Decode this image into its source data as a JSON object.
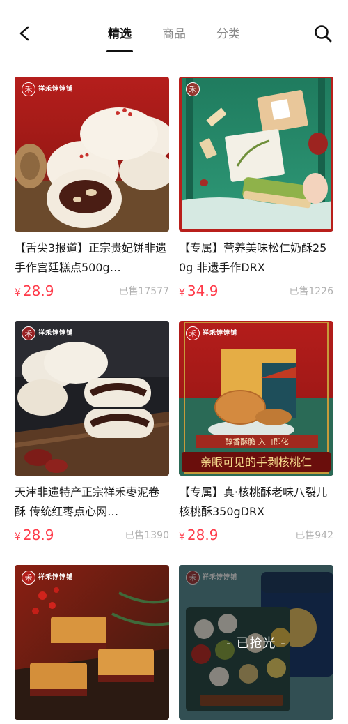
{
  "nav": {
    "tabs": [
      {
        "label": "精选",
        "active": true
      },
      {
        "label": "商品",
        "active": false
      },
      {
        "label": "分类",
        "active": false
      }
    ]
  },
  "brand_logo_text": "祥禾饽饽铺",
  "products": [
    {
      "title": "【舌尖3报道】正宗贵妃饼非遗手作宫廷糕点500g…",
      "currency": "¥",
      "price": "28.9",
      "sold": "已售17577",
      "image": "guifei-cake"
    },
    {
      "title": "【专属】营养美味松仁奶酥250g 非遗手作DRX",
      "currency": "¥",
      "price": "34.9",
      "sold": "已售1226",
      "image": "pine-nut-pastry"
    },
    {
      "title": "天津非遗特产正宗祥禾枣泥卷酥 传统红枣点心网…",
      "currency": "¥",
      "price": "28.9",
      "sold": "已售1390",
      "image": "date-roll-pastry"
    },
    {
      "title": "【专属】真·核桃酥老味八裂儿核桃酥350gDRX",
      "currency": "¥",
      "price": "28.9",
      "sold": "已售942",
      "image": "walnut-cookie"
    },
    {
      "title": "",
      "currency": "",
      "price": "",
      "sold": "",
      "image": "layered-cake"
    },
    {
      "title": "",
      "currency": "",
      "price": "",
      "sold": "",
      "image": "gift-tin",
      "soldout_label": "- 已抢光 -"
    }
  ],
  "image_text": {
    "walnut_banner_1": "醇香酥脆 入口即化",
    "walnut_banner_2": "亲眼可见的手剥核桃仁"
  }
}
